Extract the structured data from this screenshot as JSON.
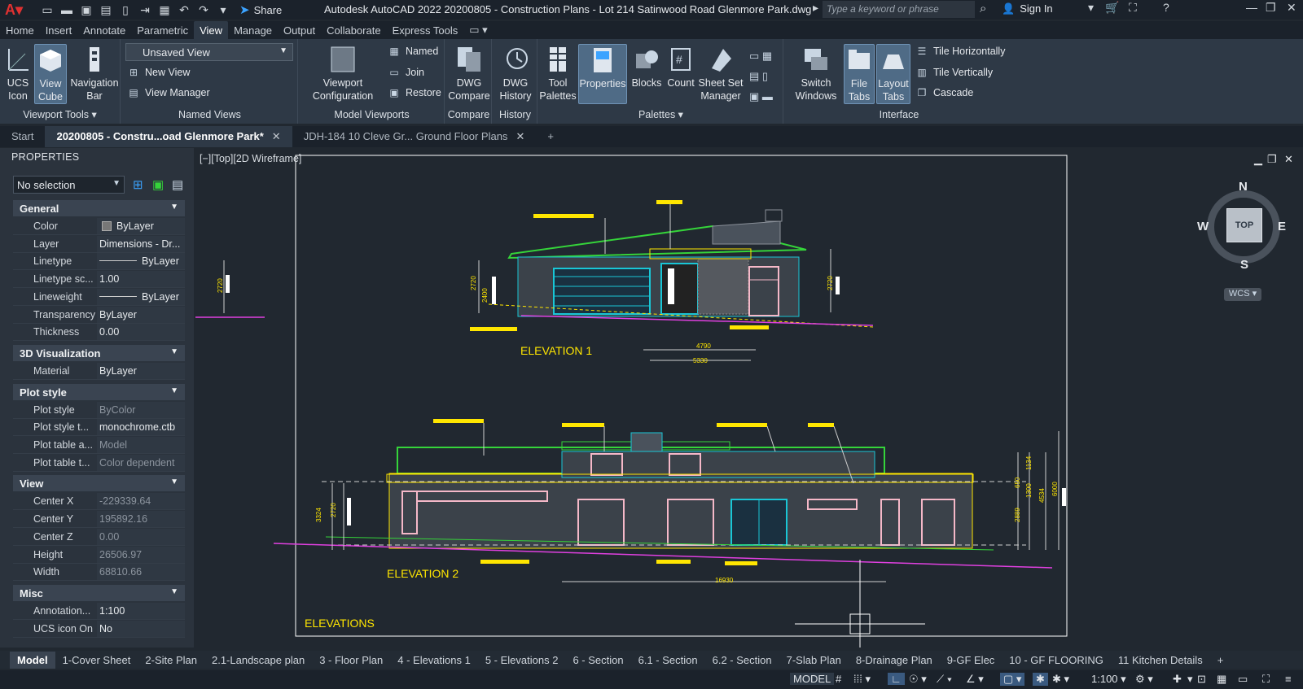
{
  "app": {
    "title": "Autodesk AutoCAD 2022   20200805 - Construction Plans - Lot 214 Satinwood Road Glenmore Park.dwg",
    "share": "Share",
    "search_placeholder": "Type a keyword or phrase",
    "sign_in": "Sign In"
  },
  "ribbon_tabs": [
    "Home",
    "Insert",
    "Annotate",
    "Parametric",
    "View",
    "Manage",
    "Output",
    "Collaborate",
    "Express Tools"
  ],
  "ribbon": {
    "viewport_tools": {
      "title": "Viewport Tools",
      "ucs": "UCS\nIcon",
      "cube": "View\nCube",
      "nav": "Navigation\nBar"
    },
    "named_views": {
      "title": "Named Views",
      "current": "Unsaved View",
      "new_view": "New View",
      "view_manager": "View Manager"
    },
    "model_viewports": {
      "title": "Model Viewports",
      "config": "Viewport\nConfiguration",
      "named": "Named",
      "join": "Join",
      "restore": "Restore"
    },
    "compare": {
      "title": "Compare",
      "dwg_compare": "DWG\nCompare"
    },
    "history": {
      "title": "History",
      "dwg_history": "DWG\nHistory"
    },
    "palettes": {
      "title": "Palettes",
      "tool_palettes": "Tool\nPalettes",
      "properties": "Properties",
      "blocks": "Blocks",
      "count": "Count",
      "sheet_set": "Sheet Set\nManager"
    },
    "interface": {
      "title": "Interface",
      "switch_windows": "Switch\nWindows",
      "file_tabs": "File\nTabs",
      "layout_tabs": "Layout\nTabs",
      "tile_h": "Tile Horizontally",
      "tile_v": "Tile Vertically",
      "cascade": "Cascade"
    }
  },
  "doc_tabs": [
    {
      "label": "Start",
      "active": false,
      "closable": false
    },
    {
      "label": "20200805 - Constru...oad Glenmore Park*",
      "active": true,
      "closable": true
    },
    {
      "label": "JDH-184 10 Cleve Gr... Ground Floor Plans",
      "active": false,
      "closable": true
    }
  ],
  "properties": {
    "header": "PROPERTIES",
    "selection": "No selection",
    "sections": [
      {
        "name": "General",
        "rows": [
          {
            "k": "Color",
            "v": "ByLayer",
            "swatch": true
          },
          {
            "k": "Layer",
            "v": "Dimensions - Dr..."
          },
          {
            "k": "Linetype",
            "v": "ByLayer",
            "line": true
          },
          {
            "k": "Linetype sc...",
            "v": "1.00"
          },
          {
            "k": "Lineweight",
            "v": "ByLayer",
            "line": true
          },
          {
            "k": "Transparency",
            "v": "ByLayer"
          },
          {
            "k": "Thickness",
            "v": "0.00"
          }
        ]
      },
      {
        "name": "3D Visualization",
        "rows": [
          {
            "k": "Material",
            "v": "ByLayer"
          }
        ]
      },
      {
        "name": "Plot style",
        "rows": [
          {
            "k": "Plot style",
            "v": "ByColor",
            "dim": true
          },
          {
            "k": "Plot style t...",
            "v": "monochrome.ctb"
          },
          {
            "k": "Plot table a...",
            "v": "Model",
            "dim": true
          },
          {
            "k": "Plot table t...",
            "v": "Color dependent",
            "dim": true
          }
        ]
      },
      {
        "name": "View",
        "rows": [
          {
            "k": "Center X",
            "v": "-229339.64",
            "dim": true
          },
          {
            "k": "Center Y",
            "v": "195892.16",
            "dim": true
          },
          {
            "k": "Center Z",
            "v": "0.00",
            "dim": true
          },
          {
            "k": "Height",
            "v": "26506.97",
            "dim": true
          },
          {
            "k": "Width",
            "v": "68810.66",
            "dim": true
          }
        ]
      },
      {
        "name": "Misc",
        "rows": [
          {
            "k": "Annotation...",
            "v": "1:100"
          },
          {
            "k": "UCS icon On",
            "v": "No"
          }
        ]
      }
    ]
  },
  "viewport": {
    "label": "[−][Top][2D Wireframe]",
    "compass": {
      "n": "N",
      "s": "S",
      "e": "E",
      "w": "W",
      "top": "TOP",
      "wcs": "WCS"
    }
  },
  "drawing": {
    "elevation1": "ELEVATION 1",
    "elevation2": "ELEVATION 2",
    "elevations": "ELEVATIONS",
    "dims": {
      "d5330": "5330",
      "d4790": "4790",
      "d16930": "16930",
      "d2720": "2720",
      "d2400": "2400",
      "d3324": "3324",
      "d6000": "6000",
      "d4534": "4534",
      "d1134": "1134",
      "d1300": "1300",
      "d2889": "2889",
      "d650": "650"
    }
  },
  "layout_tabs": [
    "Model",
    "1-Cover Sheet",
    "2-Site Plan",
    "2.1-Landscape plan",
    "3 - Floor Plan",
    "4 - Elevations 1",
    "5 - Elevations 2",
    "6 - Section",
    "6.1 - Section",
    "6.2 - Section",
    "7-Slab Plan",
    "8-Drainage Plan",
    "9-GF Elec",
    "10 - GF FLOORING",
    "11 Kitchen Details"
  ],
  "status": {
    "model": "MODEL",
    "scale": "1:100"
  },
  "colors": {
    "bg": "#212830",
    "ribbon": "#2e3946",
    "titlebar": "#1b222b",
    "yellow": "#ffe600",
    "green": "#35d43a",
    "cyan": "#19c6d6",
    "magenta": "#e040e0"
  }
}
